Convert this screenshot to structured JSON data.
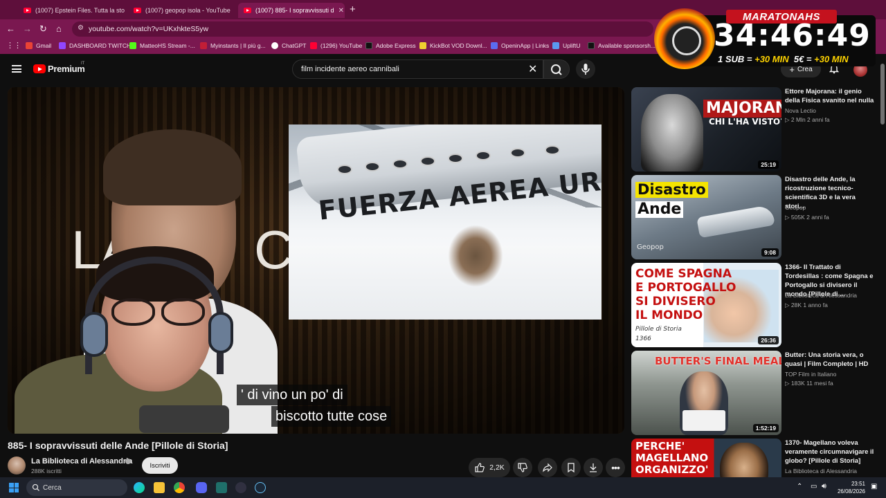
{
  "browser": {
    "tabs": [
      {
        "label": "(1007) Epstein Files. Tutta la sto"
      },
      {
        "label": "(1007) geopop isola - YouTube"
      },
      {
        "label": "(1007) 885- I sopravvissuti d"
      }
    ],
    "url": "youtube.com/watch?v=UKxhkteS5yw",
    "bookmarks": [
      {
        "label": "Gmail",
        "color": "#ea4335"
      },
      {
        "label": "DASHBOARD TWITCH",
        "color": "#9146ff"
      },
      {
        "label": "MatteoHS Stream -...",
        "color": "#53fc18"
      },
      {
        "label": "Myinstants | Il più g...",
        "color": "#c21e36"
      },
      {
        "label": "ChatGPT",
        "color": "#ffffff"
      },
      {
        "label": "(1296) YouTube",
        "color": "#ff0033"
      },
      {
        "label": "Adobe Express",
        "color": "#111111"
      },
      {
        "label": "KickBot VOD Downl...",
        "color": "#f0d030"
      },
      {
        "label": "OpeninApp | Links",
        "color": "#5b6cf0"
      },
      {
        "label": "UpliftU",
        "color": "#5a9af0"
      },
      {
        "label": "Available sponsorsh...",
        "color": "#111111"
      }
    ]
  },
  "youtube": {
    "logo_text": "Premium",
    "country_code": "IT",
    "search_query": "film incidente aereo cannibali",
    "create_label": "Crea"
  },
  "overlay": {
    "title": "MARATONAHS",
    "timer": "34:46:49",
    "rule1_a": "1 SUB = ",
    "rule1_b": "+30 MIN",
    "rule2_a": "5€ = ",
    "rule2_b": "+30 MIN"
  },
  "video": {
    "bg_text_left": "LA",
    "bg_text_right": "CA",
    "inset_text": "FUERZA AEREA URUG",
    "subtitle_line1": "' di vino un po' di",
    "subtitle_line2": "biscotto tutte cose",
    "title": "885- I sopravvissuti delle Ande [Pillole di Storia]",
    "channel": "La Biblioteca di Alessandria",
    "subscribers": "288K iscritti",
    "subscribe_label": "Iscriviti",
    "likes": "2,2K"
  },
  "recommendations": [
    {
      "title": "Ettore Majorana: il genio della Fisica svanito nel nulla",
      "channel": "Nova Lectio",
      "meta": "▷ 2 Mln   2 anni fa",
      "duration": "25:19",
      "thumb_line1": "MAJORANA",
      "thumb_line2": "CHI L'HA VISTO?",
      "verified": true
    },
    {
      "title": "Disastro delle Ande, la ricostruzione tecnico-scientifica 3D e la vera stori...",
      "channel": "Geopop",
      "meta": "▷ 505K   2 anni fa",
      "duration": "9:08",
      "thumb_line1": "Disastro",
      "thumb_line2": "Ande",
      "thumb_brand": "Geopop",
      "verified": true
    },
    {
      "title": "1366- Il Trattato di Tordesillas : come Spagna e Portogallo si divisero il mondo [Pillole di ...",
      "channel": "La Biblioteca di Alessandria",
      "meta": "▷ 28K   1 anno fa",
      "duration": "26:36",
      "thumb_line1": "COME SPAGNA",
      "thumb_line2": "E PORTOGALLO",
      "thumb_line3": "SI DIVISERO",
      "thumb_line4": "IL MONDO",
      "thumb_line5": "Pillole di Storia",
      "thumb_line6": "1366",
      "verified": true
    },
    {
      "title": "Butter: Una storia vera, o quasi | Film Completo | HD",
      "channel": "TOP Film in Italiano",
      "meta": "▷ 183K   11 mesi fa",
      "duration": "1:52:19",
      "thumb_line1": "BUTTER'S FINAL MEAL",
      "verified": false
    },
    {
      "title": "1370- Magellano voleva veramente circumnavigare il globo? [Pillole di Storia]",
      "channel": "La Biblioteca di Alessandria",
      "meta": "",
      "duration": "",
      "thumb_line1": "PERCHE'",
      "thumb_line2": "MAGELLANO",
      "thumb_line3": "ORGANIZZO'",
      "verified": true
    }
  ],
  "taskbar": {
    "search_placeholder": "Cerca",
    "time": "23:51",
    "date": "26/08/2026"
  }
}
